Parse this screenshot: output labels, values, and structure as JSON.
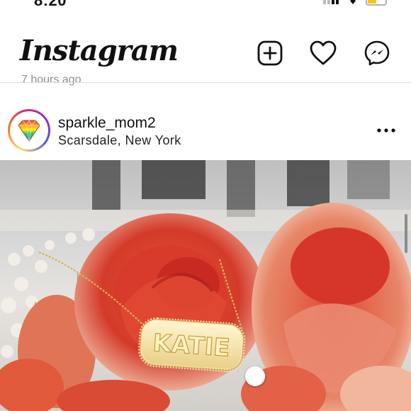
{
  "status_bar": {
    "time": "8:20"
  },
  "header": {
    "logo": "Instagram",
    "icons": [
      "new-post-icon",
      "heart-icon",
      "messenger-icon"
    ]
  },
  "previous_post": {
    "timestamp_partial": "7 hours ago"
  },
  "post": {
    "username": "sparkle_mom2",
    "location": "Scarsdale, New York",
    "more_icon": "more-options-icon",
    "necklace_text": "KATIE"
  },
  "colors": {
    "text": "#111111",
    "divider": "#dbdbdb",
    "battery": "#f5c518",
    "rose": "#d9432f"
  }
}
